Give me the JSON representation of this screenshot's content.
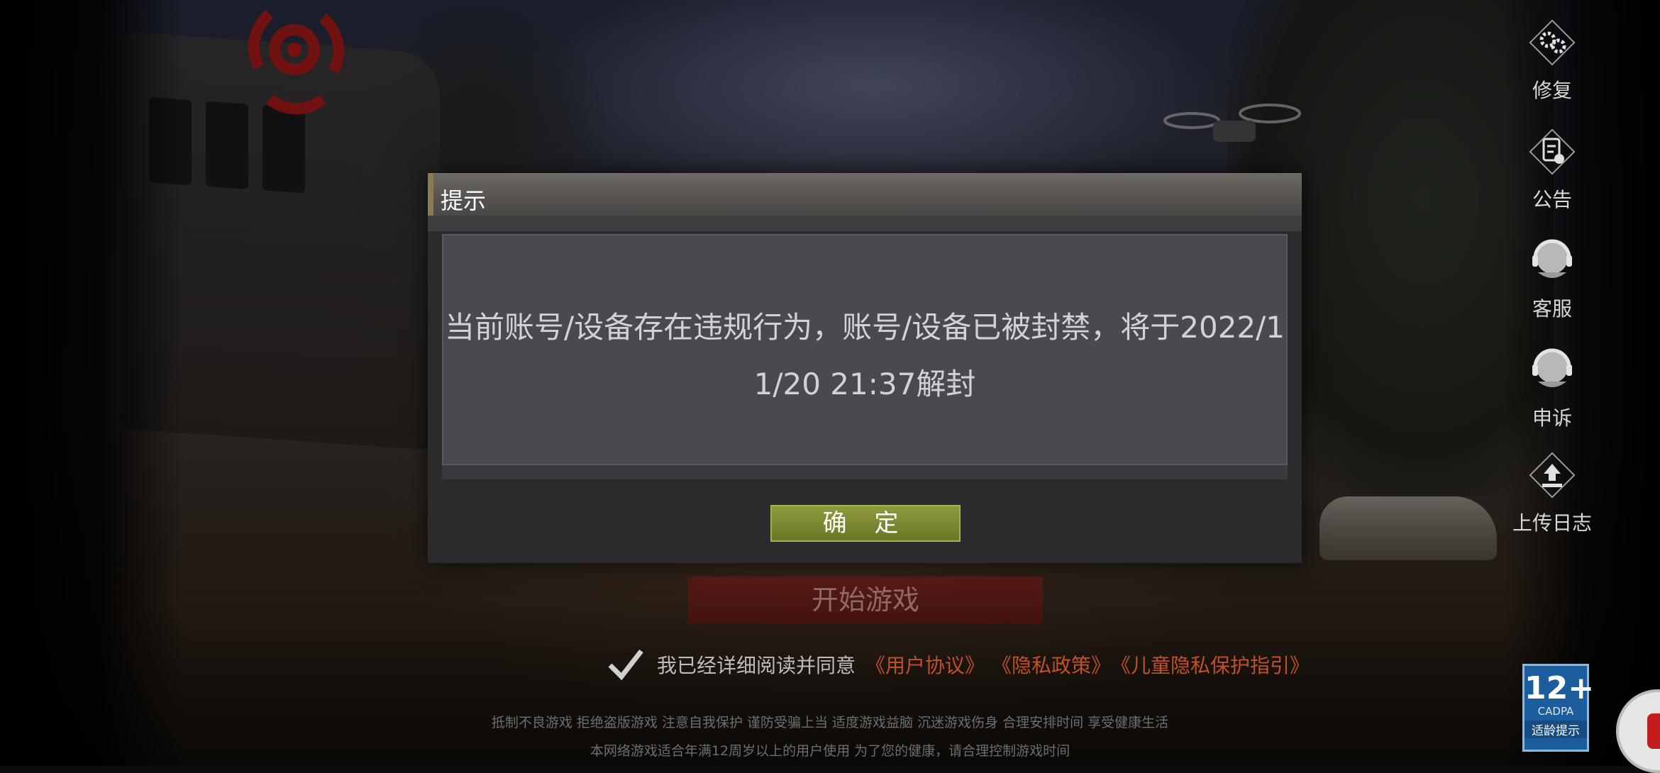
{
  "dialog": {
    "title": "提示",
    "message": "当前账号/设备存在违规行为，账号/设备已被封禁，将于2022/11/20 21:37解封",
    "confirm_label": "确 定"
  },
  "start_button_label": "开始游戏",
  "agreement": {
    "text": "我已经详细阅读并同意",
    "links": [
      "《用户协议》",
      "《隐私政策》",
      "《儿童隐私保护指引》"
    ],
    "checked": true
  },
  "footer": {
    "line1": "抵制不良游戏 拒绝盗版游戏 注意自我保护 谨防受骗上当 适度游戏益脑 沉迷游戏伤身 合理安排时间 享受健康生活",
    "line2": "本网络游戏适合年满12周岁以上的用户使用   为了您的健康，请合理控制游戏时间"
  },
  "side_menu": [
    {
      "label": "修复",
      "icon": "gears-icon"
    },
    {
      "label": "公告",
      "icon": "notice-icon"
    },
    {
      "label": "客服",
      "icon": "headset-icon"
    },
    {
      "label": "申诉",
      "icon": "headset-icon"
    },
    {
      "label": "上传日志",
      "icon": "upload-icon"
    }
  ],
  "age_badge": {
    "rating": "12+",
    "org": "CADPA",
    "tip": "适龄提示"
  },
  "colors": {
    "confirm_button": "#7c8733",
    "link": "#c0502a",
    "start_button": "#6e1414"
  }
}
